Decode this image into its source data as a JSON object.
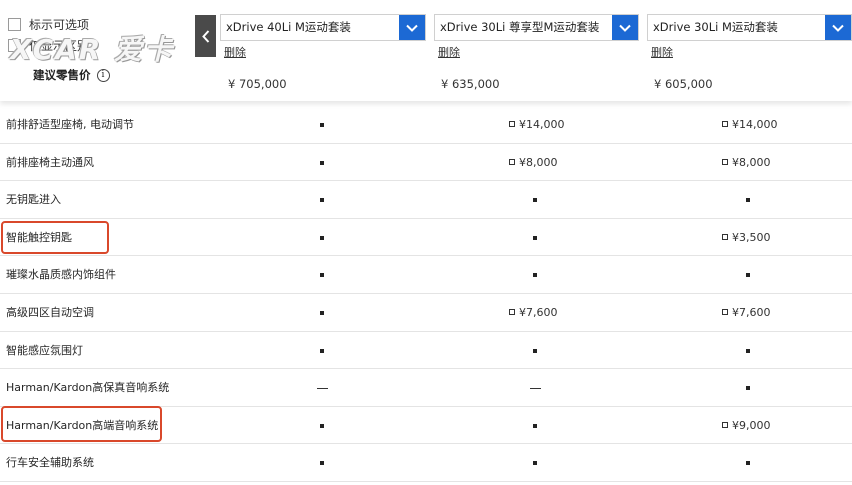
{
  "options": {
    "option1": "标示可选项",
    "option2": "仅显示区别"
  },
  "watermark": "XCAR 爱卡",
  "price_label": "建议零售价",
  "info_icon": "i",
  "prev_icon": "chevron-left-icon",
  "colors": {
    "accent": "#1c69d4",
    "highlight": "#d9482b"
  },
  "models": [
    {
      "name": "xDrive 40Li M运动套装",
      "delete": "删除",
      "price": "¥ 705,000"
    },
    {
      "name": "xDrive 30Li 尊享型M运动套装",
      "delete": "删除",
      "price": "¥ 635,000"
    },
    {
      "name": "xDrive 30Li M运动套装",
      "delete": "删除",
      "price": "¥ 605,000"
    }
  ],
  "features": [
    {
      "name": "前排舒适型座椅, 电动调节",
      "values": [
        "std",
        "¥14,000",
        "¥14,000"
      ]
    },
    {
      "name": "前排座椅主动通风",
      "values": [
        "std",
        "¥8,000",
        "¥8,000"
      ]
    },
    {
      "name": "无钥匙进入",
      "values": [
        "std",
        "std",
        "std"
      ]
    },
    {
      "name": "智能触控钥匙",
      "values": [
        "std",
        "std",
        "¥3,500"
      ]
    },
    {
      "name": "璀璨水晶质感内饰组件",
      "values": [
        "std",
        "std",
        "std"
      ]
    },
    {
      "name": "高级四区自动空调",
      "values": [
        "std",
        "¥7,600",
        "¥7,600"
      ]
    },
    {
      "name": "智能感应氛围灯",
      "values": [
        "std",
        "std",
        "std"
      ]
    },
    {
      "name": "Harman/Kardon高保真音响系统",
      "values": [
        "none",
        "none",
        "std"
      ]
    },
    {
      "name": "Harman/Kardon高端音响系统",
      "values": [
        "std",
        "std",
        "¥9,000"
      ]
    },
    {
      "name": "行车安全辅助系统",
      "values": [
        "std",
        "std",
        "std"
      ]
    }
  ]
}
